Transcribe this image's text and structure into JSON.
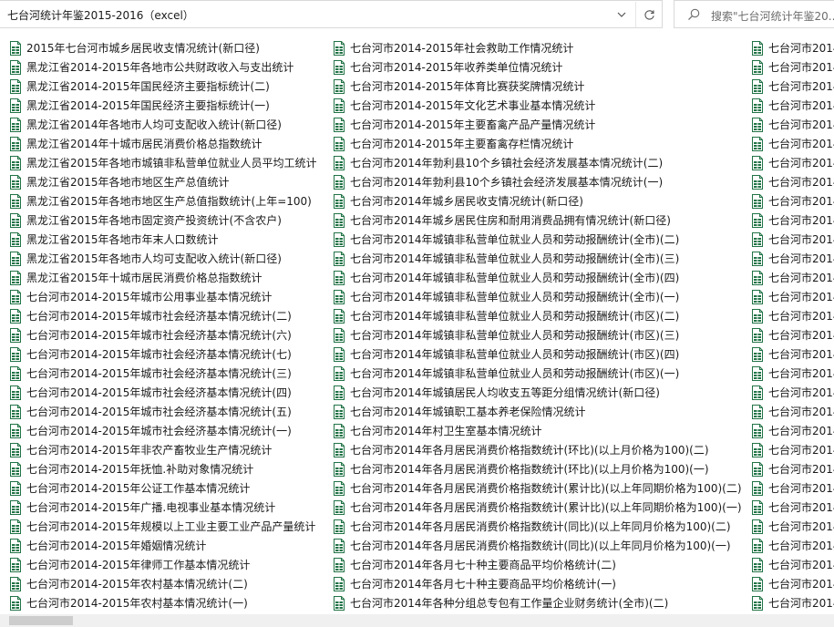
{
  "address_bar": {
    "path": "七台河统计年鉴2015-2016（excel）"
  },
  "search": {
    "placeholder": "搜索\"七台河统计年鉴20..."
  },
  "icons": {
    "file": "excel-file-icon",
    "dropdown": "chevron-down-icon",
    "refresh": "refresh-icon",
    "search": "search-icon"
  },
  "colors": {
    "file_icon": "#217346"
  },
  "columns": [
    {
      "files": [
        "2015年七台河市城乡居民收支情况统计(新口径)",
        "黑龙江省2014-2015年各地市公共财政收入与支出统计",
        "黑龙江省2014-2015年国民经济主要指标统计(二)",
        "黑龙江省2014-2015年国民经济主要指标统计(一)",
        "黑龙江省2014年各地市人均可支配收入统计(新口径)",
        "黑龙江省2014年十城市居民消费价格总指数统计",
        "黑龙江省2015年各地市城镇非私营单位就业人员平均工统计",
        "黑龙江省2015年各地市地区生产总值统计",
        "黑龙江省2015年各地市地区生产总值指数统计(上年=100)",
        "黑龙江省2015年各地市固定资产投资统计(不含农户)",
        "黑龙江省2015年各地市年末人口数统计",
        "黑龙江省2015年各地市人均可支配收入统计(新口径)",
        "黑龙江省2015年十城市居民消费价格总指数统计",
        "七台河市2014-2015年城市公用事业基本情况统计",
        "七台河市2014-2015年城市社会经济基本情况统计(二)",
        "七台河市2014-2015年城市社会经济基本情况统计(六)",
        "七台河市2014-2015年城市社会经济基本情况统计(七)",
        "七台河市2014-2015年城市社会经济基本情况统计(三)",
        "七台河市2014-2015年城市社会经济基本情况统计(四)",
        "七台河市2014-2015年城市社会经济基本情况统计(五)",
        "七台河市2014-2015年城市社会经济基本情况统计(一)",
        "七台河市2014-2015年非农产畜牧业生产情况统计",
        "七台河市2014-2015年抚恤.补助对象情况统计",
        "七台河市2014-2015年公证工作基本情况统计",
        "七台河市2014-2015年广播.电视事业基本情况统计",
        "七台河市2014-2015年规模以上工业主要工业产品产量统计",
        "七台河市2014-2015年婚姻情况统计",
        "七台河市2014-2015年律师工作基本情况统计",
        "七台河市2014-2015年农村基本情况统计(二)",
        "七台河市2014-2015年农村基本情况统计(一)"
      ]
    },
    {
      "files": [
        "七台河市2014-2015年社会救助工作情况统计",
        "七台河市2014-2015年收养类单位情况统计",
        "七台河市2014-2015年体育比赛获奖牌情况统计",
        "七台河市2014-2015年文化艺术事业基本情况统计",
        "七台河市2014-2015年主要畜禽产品产量情况统计",
        "七台河市2014-2015年主要畜禽存栏情况统计",
        "七台河市2014年勃利县10个乡镇社会经济发展基本情况统计(二)",
        "七台河市2014年勃利县10个乡镇社会经济发展基本情况统计(一)",
        "七台河市2014年城乡居民收支情况统计(新口径)",
        "七台河市2014年城乡居民住房和耐用消费品拥有情况统计(新口径)",
        "七台河市2014年城镇非私营单位就业人员和劳动报酬统计(全市)(二)",
        "七台河市2014年城镇非私营单位就业人员和劳动报酬统计(全市)(三)",
        "七台河市2014年城镇非私营单位就业人员和劳动报酬统计(全市)(四)",
        "七台河市2014年城镇非私营单位就业人员和劳动报酬统计(全市)(一)",
        "七台河市2014年城镇非私营单位就业人员和劳动报酬统计(市区)(二)",
        "七台河市2014年城镇非私营单位就业人员和劳动报酬统计(市区)(三)",
        "七台河市2014年城镇非私营单位就业人员和劳动报酬统计(市区)(四)",
        "七台河市2014年城镇非私营单位就业人员和劳动报酬统计(市区)(一)",
        "七台河市2014年城镇居民人均收支五等距分组情况统计(新口径)",
        "七台河市2014年城镇职工基本养老保险情况统计",
        "七台河市2014年村卫生室基本情况统计",
        "七台河市2014年各月居民消费价格指数统计(环比)(以上月价格为100)(二)",
        "七台河市2014年各月居民消费价格指数统计(环比)(以上月价格为100)(一)",
        "七台河市2014年各月居民消费价格指数统计(累计比)(以上年同期价格为100)(二)",
        "七台河市2014年各月居民消费价格指数统计(累计比)(以上年同期价格为100)(一)",
        "七台河市2014年各月居民消费价格指数统计(同比)(以上年同月价格为100)(二)",
        "七台河市2014年各月居民消费价格指数统计(同比)(以上年同月价格为100)(一)",
        "七台河市2014年各月七十种主要商品平均价格统计(二)",
        "七台河市2014年各月七十种主要商品平均价格统计(一)",
        "七台河市2014年各种分组总专包有工作量企业财务统计(全市)(二)"
      ]
    },
    {
      "files": [
        "七台河市2014",
        "七台河市2014",
        "七台河市2014",
        "七台河市2014",
        "七台河市2014",
        "七台河市2014",
        "七台河市2014",
        "七台河市2014",
        "七台河市2014",
        "七台河市2014",
        "七台河市2014",
        "七台河市2014",
        "七台河市2014",
        "七台河市2014",
        "七台河市2014",
        "七台河市2014",
        "七台河市2014",
        "七台河市2014",
        "七台河市2014",
        "七台河市2014",
        "七台河市2014",
        "七台河市2014",
        "七台河市2014",
        "七台河市2014",
        "七台河市2014",
        "七台河市2014",
        "七台河市2014",
        "七台河市2014",
        "七台河市2014",
        "七台河市2014"
      ]
    }
  ]
}
